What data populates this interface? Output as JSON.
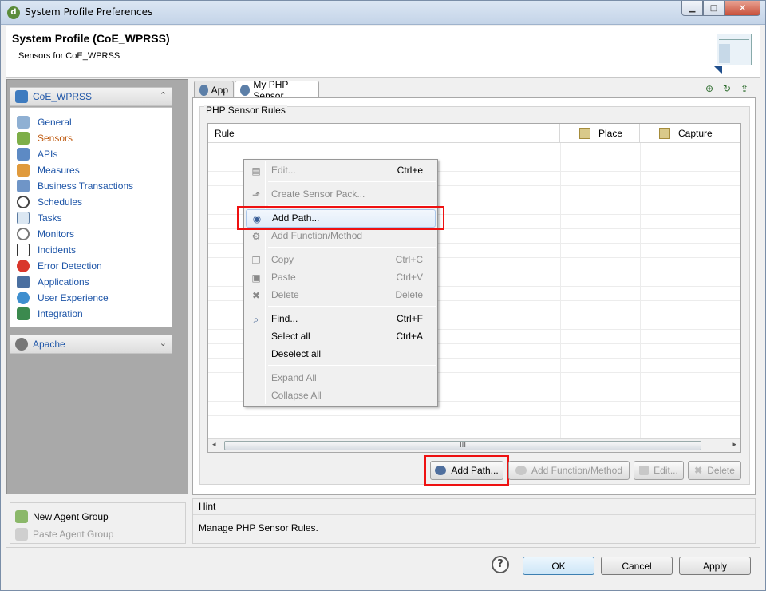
{
  "window": {
    "title": "System Profile Preferences"
  },
  "header": {
    "title": "System Profile (CoE_WPRSS)",
    "subtitle": "Sensors for CoE_WPRSS"
  },
  "sidebar": {
    "profile_section": "CoE_WPRSS",
    "items": [
      {
        "label": "General",
        "icon": "general-icon"
      },
      {
        "label": "Sensors",
        "icon": "sensors-icon",
        "active": true
      },
      {
        "label": "APIs",
        "icon": "apis-icon"
      },
      {
        "label": "Measures",
        "icon": "measures-icon"
      },
      {
        "label": "Business Transactions",
        "icon": "business-transactions-icon"
      },
      {
        "label": "Schedules",
        "icon": "schedules-icon"
      },
      {
        "label": "Tasks",
        "icon": "tasks-icon"
      },
      {
        "label": "Monitors",
        "icon": "monitors-icon"
      },
      {
        "label": "Incidents",
        "icon": "incidents-icon"
      },
      {
        "label": "Error Detection",
        "icon": "error-detection-icon"
      },
      {
        "label": "Applications",
        "icon": "applications-icon"
      },
      {
        "label": "User Experience",
        "icon": "user-experience-icon"
      },
      {
        "label": "Integration",
        "icon": "integration-icon"
      }
    ],
    "agent_section": "Apache",
    "agent_actions": {
      "new_group": "New Agent Group",
      "paste_group": "Paste Agent Group"
    }
  },
  "tabs": [
    {
      "label": "App"
    },
    {
      "label": "My PHP Sensor",
      "active": true
    }
  ],
  "group_label": "PHP Sensor Rules",
  "table": {
    "columns": [
      "Rule",
      "Place",
      "Capture"
    ],
    "scroll_thumb": "III"
  },
  "buttons": {
    "add_path": "Add Path...",
    "add_function": "Add Function/Method",
    "edit": "Edit...",
    "delete": "Delete"
  },
  "hint": {
    "label": "Hint",
    "text": "Manage PHP Sensor Rules."
  },
  "dialog": {
    "help": "?",
    "ok": "OK",
    "cancel": "Cancel",
    "apply": "Apply"
  },
  "context_menu": {
    "items": [
      {
        "label": "Edit...",
        "shortcut": "Ctrl+e",
        "disabled": true
      },
      {
        "label": "Create Sensor Pack...",
        "shortcut": "",
        "disabled": true
      },
      {
        "label": "Add Path...",
        "shortcut": "",
        "disabled": false,
        "highlighted": true
      },
      {
        "label": "Add Function/Method",
        "shortcut": "",
        "disabled": true
      },
      {
        "label": "Copy",
        "shortcut": "Ctrl+C",
        "disabled": true
      },
      {
        "label": "Paste",
        "shortcut": "Ctrl+V",
        "disabled": true
      },
      {
        "label": "Delete",
        "shortcut": "Delete",
        "disabled": true
      },
      {
        "label": "Find...",
        "shortcut": "Ctrl+F",
        "disabled": false
      },
      {
        "label": "Select all",
        "shortcut": "Ctrl+A",
        "disabled": false
      },
      {
        "label": "Deselect all",
        "shortcut": "",
        "disabled": false
      },
      {
        "label": "Expand All",
        "shortcut": "",
        "disabled": true
      },
      {
        "label": "Collapse All",
        "shortcut": "",
        "disabled": true
      }
    ]
  },
  "colors": {
    "link": "#1f56a8",
    "active": "#c05c12",
    "highlight": "#e11111"
  }
}
